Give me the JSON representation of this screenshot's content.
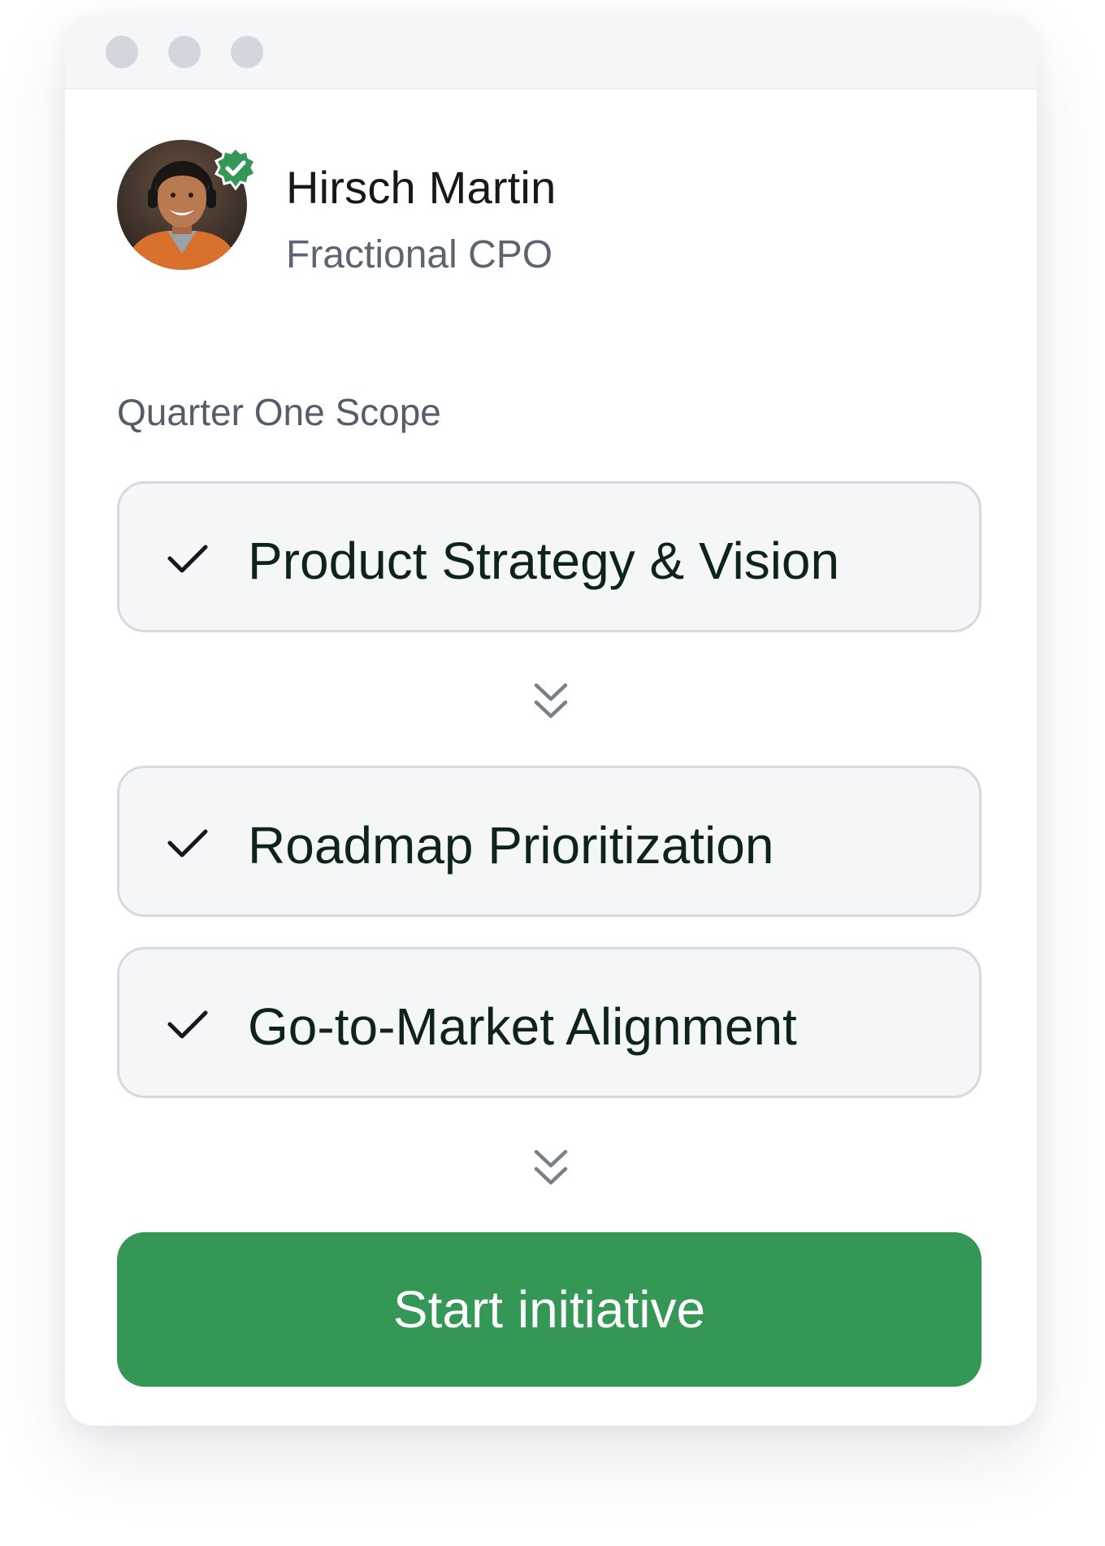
{
  "window": {
    "dots": [
      "close",
      "minimize",
      "maximize"
    ]
  },
  "profile": {
    "name": "Hirsch Martin",
    "role": "Fractional CPO",
    "verified_icon": "verified-badge-icon",
    "verified_color": "#359755"
  },
  "scope": {
    "label": "Quarter One Scope",
    "items": [
      {
        "label": "Product Strategy & Vision",
        "icon": "check-icon"
      },
      {
        "label": "Roadmap Prioritization",
        "icon": "check-icon"
      },
      {
        "label": "Go-to-Market Alignment",
        "icon": "check-icon"
      }
    ],
    "connector_icon": "double-chevron-down-icon"
  },
  "cta": {
    "label": "Start initiative",
    "color": "#359755"
  }
}
